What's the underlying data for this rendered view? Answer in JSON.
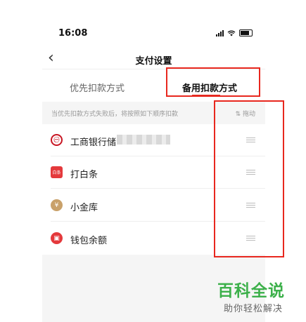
{
  "status_bar": {
    "time": "16:08"
  },
  "header": {
    "title": "支付设置"
  },
  "tabs": [
    {
      "label": "优先扣款方式",
      "active": false
    },
    {
      "label": "备用扣款方式",
      "active": true
    }
  ],
  "hint": {
    "text": "当优先扣款方式失败后，将按照如下顺序扣款",
    "drag_label": "⇅ 拖动"
  },
  "payment_methods": [
    {
      "label": "工商银行储",
      "icon": "icbc-bank-icon"
    },
    {
      "label": "打白条",
      "icon": "baitiao-icon"
    },
    {
      "label": "小金库",
      "icon": "money-bag-icon"
    },
    {
      "label": "钱包余额",
      "icon": "wallet-icon"
    }
  ],
  "icons": {
    "icbc": "㊀",
    "baitiao": "白条",
    "jinku": "¥",
    "wallet": "▣"
  },
  "watermark": {
    "title": "百科全说",
    "subtitle": "助你轻松解决"
  },
  "colors": {
    "accent": "#e02e24",
    "annotation": "#e8271e",
    "watermark": "#3cb04a"
  }
}
